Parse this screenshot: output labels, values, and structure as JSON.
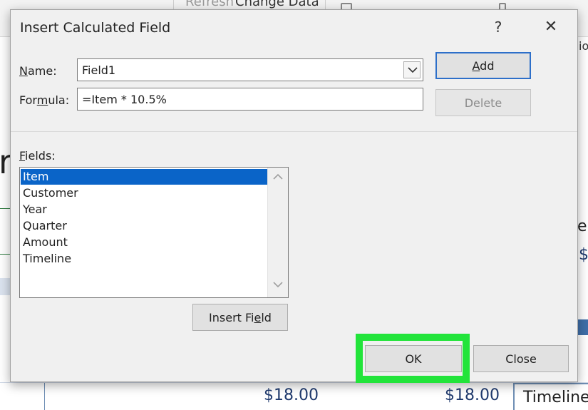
{
  "background": {
    "ribbon_refresh": "Refresh",
    "ribbon_change_data": "Change Data",
    "fragment_right_top": "io",
    "fragment_left_big": "r",
    "fragment_right_e": "e",
    "fragment_right_num": "$",
    "cell_amount_1": "$18.00",
    "cell_amount_2": "$18.00",
    "timeline_label": "Timeline"
  },
  "dialog": {
    "title": "Insert Calculated Field",
    "help_glyph": "?",
    "close_glyph": "✕",
    "name_label_prefix": "N",
    "name_label_rest": "ame:",
    "name_value": "Field1",
    "formula_label_prefix": "For",
    "formula_label_u": "m",
    "formula_label_rest": "ula:",
    "formula_value": "=Item * 10.5%",
    "add_label": "Add",
    "add_label_u": "A",
    "add_label_rest": "dd",
    "delete_label": "Delete",
    "fields_label_u": "F",
    "fields_label_rest": "ields:",
    "fields": [
      "Item",
      "Customer",
      "Year",
      "Quarter",
      "Amount",
      "Timeline"
    ],
    "selected_field_index": 0,
    "insert_field_prefix": "Insert Fi",
    "insert_field_u": "e",
    "insert_field_rest": "ld",
    "ok_label": "OK",
    "close_label": "Close"
  },
  "colors": {
    "selection": "#0a64c8",
    "highlight": "#22e43a",
    "default_button_border": "#2d6fc9"
  }
}
